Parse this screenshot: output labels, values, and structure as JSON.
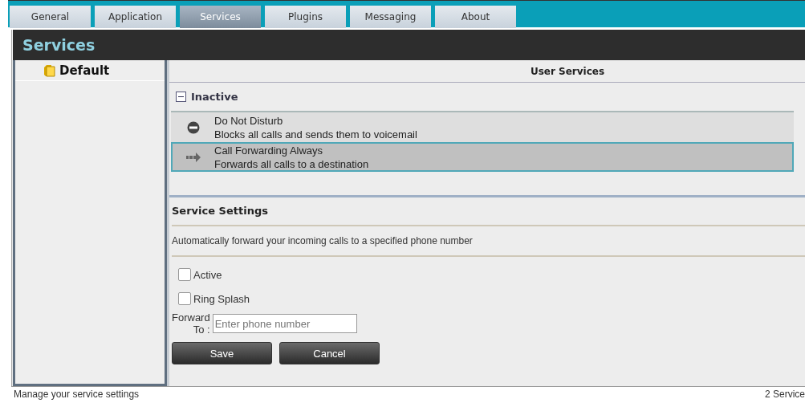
{
  "tabs": [
    {
      "label": "General",
      "selected": false
    },
    {
      "label": "Application",
      "selected": false
    },
    {
      "label": "Services",
      "selected": true
    },
    {
      "label": "Plugins",
      "selected": false
    },
    {
      "label": "Messaging",
      "selected": false
    },
    {
      "label": "About",
      "selected": false
    }
  ],
  "header": {
    "title": "Services"
  },
  "sidebar": {
    "items": [
      {
        "label": "Default",
        "selected": true
      }
    ]
  },
  "user_services": {
    "title": "User Services",
    "group": {
      "label": "Inactive",
      "expanded": true
    },
    "items": [
      {
        "kind": "dnd",
        "name": "Do Not Disturb",
        "description": "Blocks all calls and sends them to voicemail",
        "selected": false
      },
      {
        "kind": "forward",
        "name": "Call Forwarding Always",
        "description": "Forwards all calls to a destination",
        "selected": true
      }
    ]
  },
  "service_settings": {
    "title": "Service Settings",
    "description": "Automatically forward your incoming calls to a specified phone number",
    "checkboxes": [
      {
        "label": "Active",
        "checked": false
      },
      {
        "label": "Ring Splash",
        "checked": false
      }
    ],
    "forward_to": {
      "label_1": "Forward",
      "label_2": "To :",
      "placeholder": "Enter phone number"
    },
    "buttons": [
      "Save",
      "Cancel"
    ]
  },
  "status_bar": {
    "left": "Manage your service settings",
    "right": "2 Service"
  }
}
